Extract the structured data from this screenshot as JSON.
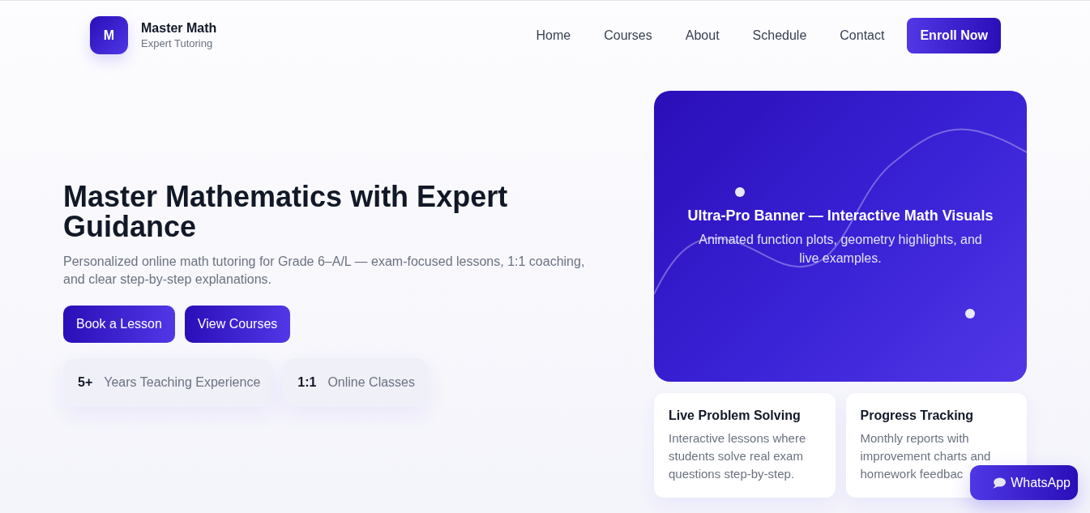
{
  "brand": {
    "logo_letter": "M",
    "name": "Master Math",
    "tagline": "Expert Tutoring"
  },
  "nav": {
    "links": [
      "Home",
      "Courses",
      "About",
      "Schedule",
      "Contact"
    ],
    "cta": "Enroll Now"
  },
  "hero": {
    "title": "Master Mathematics with Expert Guidance",
    "subtitle": "Personalized online math tutoring for Grade 6–A/L — exam-focused lessons, 1:1 coaching, and clear step-by-step explanations.",
    "buttons": [
      "Book a Lesson",
      "View Courses"
    ],
    "stats": [
      {
        "value": "5+",
        "label": "Years Teaching Experience"
      },
      {
        "value": "1:1",
        "label": "Online Classes"
      }
    ]
  },
  "banner": {
    "title": "Ultra-Pro Banner — Interactive Math Visuals",
    "subtitle": "Animated function plots, geometry highlights, and live examples."
  },
  "features": [
    {
      "title": "Live Problem Solving",
      "text": "Interactive lessons where students solve real exam questions step-by-step."
    },
    {
      "title": "Progress Tracking",
      "text": "Monthly reports with improvement charts and homework feedbac"
    }
  ],
  "whatsapp": {
    "label": "WhatsApp"
  }
}
